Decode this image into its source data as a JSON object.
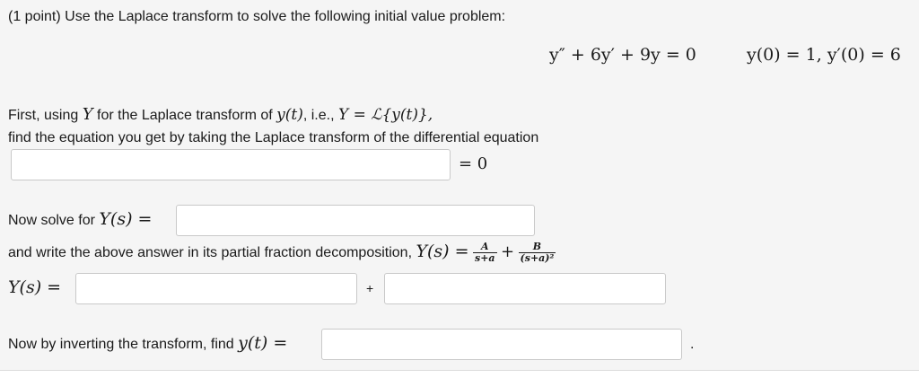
{
  "question": {
    "prompt": "(1 point) Use the Laplace transform to solve the following initial value problem:",
    "ode": "y″ + 6y′ + 9y = 0",
    "initial_conditions": "y(0) = 1,  y′(0) = 6"
  },
  "step1": {
    "text_a": "First, using ",
    "sym_Y": "Y",
    "text_b": " for the Laplace transform of ",
    "sym_yt": "y(t)",
    "text_c": ", i.e., ",
    "sym_def": "Y = ℒ{y(t)},",
    "line2": "find the equation you get by taking the Laplace transform of the differential equation",
    "rhs": "= 0"
  },
  "step2": {
    "text": "Now solve for ",
    "sym": "Y(s) ="
  },
  "step3": {
    "text": "and write the above answer in its partial fraction decomposition, ",
    "sym": "Y(s) =",
    "frac1_num": "A",
    "frac1_den": "s+a",
    "plus": "+",
    "frac2_num": "B",
    "frac2_den": "(s+a)²",
    "answer_label": "Y(s) =",
    "answer_plus": "+"
  },
  "step4": {
    "text": "Now by inverting the transform, find ",
    "sym": "y(t) =",
    "trailing": "."
  }
}
